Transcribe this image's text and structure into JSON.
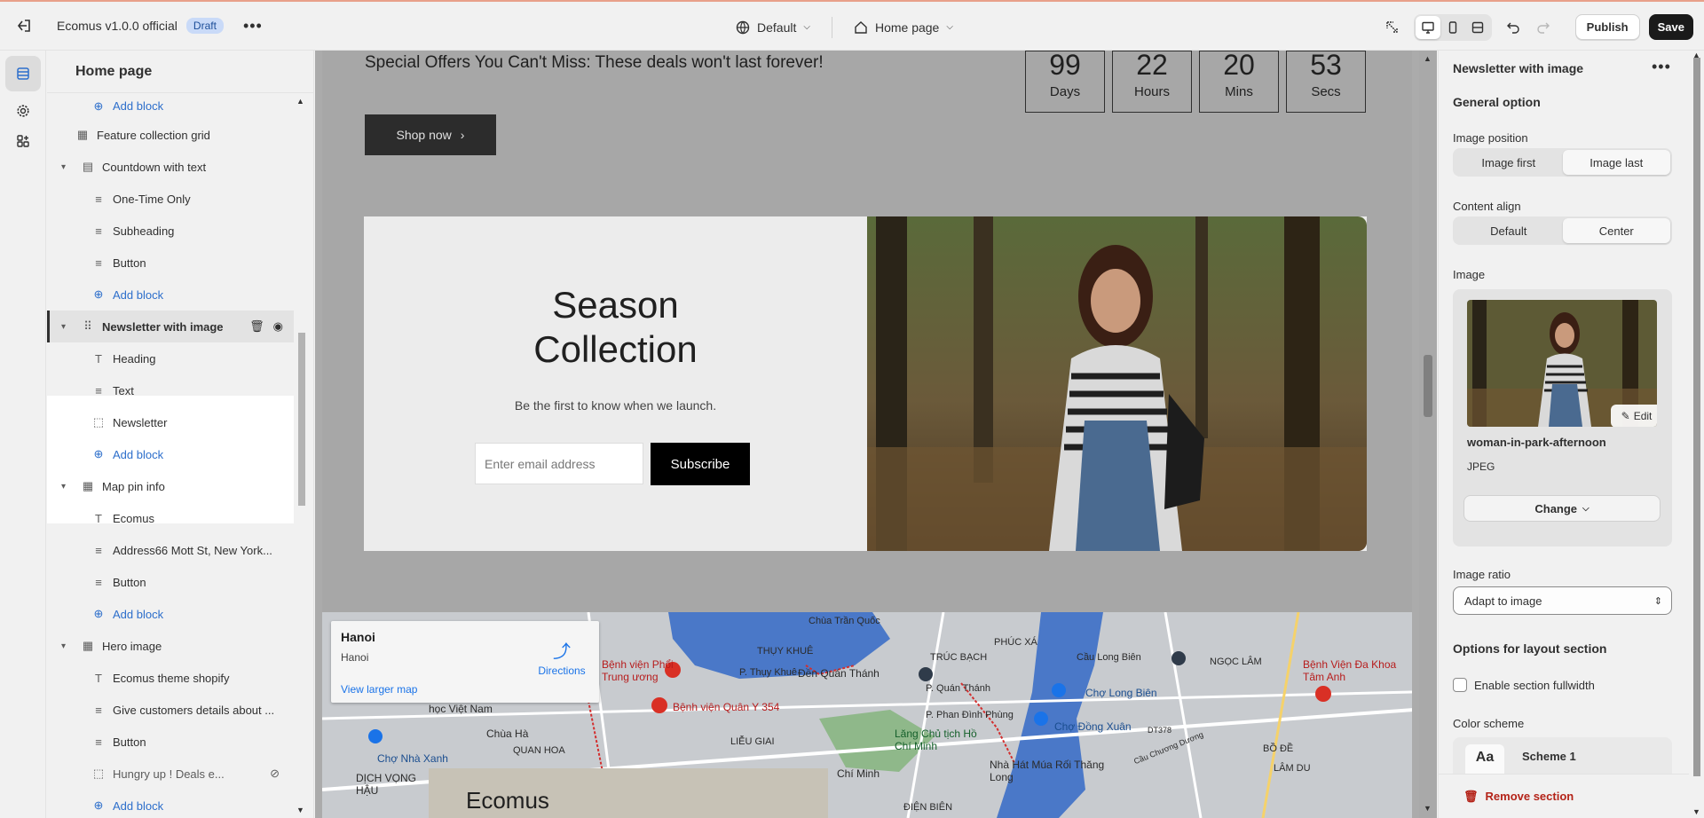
{
  "topbar": {
    "app_title": "Ecomus v1.0.0 official",
    "status_badge": "Draft",
    "theme_select": "Default",
    "page_select": "Home page",
    "publish_label": "Publish",
    "save_label": "Save"
  },
  "left_panel": {
    "title": "Home page",
    "items": [
      {
        "label": "Add block",
        "type": "add"
      },
      {
        "label": "Feature collection grid",
        "type": "top-block",
        "icon": "image-icon"
      },
      {
        "label": "Countdown with text",
        "type": "section",
        "icon": "section-icon"
      },
      {
        "label": "One-Time Only",
        "type": "block",
        "icon": "text-lines-icon"
      },
      {
        "label": "Subheading",
        "type": "block",
        "icon": "text-lines-icon"
      },
      {
        "label": "Button",
        "type": "block",
        "icon": "text-lines-icon"
      },
      {
        "label": "Add block",
        "type": "add"
      },
      {
        "label": "Newsletter with image",
        "type": "section-selected"
      },
      {
        "label": "Heading",
        "type": "block",
        "icon": "heading-icon"
      },
      {
        "label": "Text",
        "type": "block",
        "icon": "text-lines-icon"
      },
      {
        "label": "Newsletter",
        "type": "block",
        "icon": "dashed-box-icon"
      },
      {
        "label": "Add block",
        "type": "add"
      },
      {
        "label": "Map pin info",
        "type": "section",
        "icon": "image-icon"
      },
      {
        "label": "Ecomus",
        "type": "block",
        "icon": "heading-icon"
      },
      {
        "label": "Address66 Mott St, New York...",
        "type": "block",
        "icon": "text-lines-icon"
      },
      {
        "label": "Button",
        "type": "block",
        "icon": "text-lines-icon"
      },
      {
        "label": "Add block",
        "type": "add"
      },
      {
        "label": "Hero image",
        "type": "section",
        "icon": "image-icon"
      },
      {
        "label": "Ecomus theme shopify",
        "type": "block",
        "icon": "heading-icon"
      },
      {
        "label": "Give customers details about ...",
        "type": "block",
        "icon": "text-lines-icon"
      },
      {
        "label": "Button",
        "type": "block",
        "icon": "text-lines-icon"
      },
      {
        "label": "Hungry up ! Deals e...",
        "type": "block-hidden",
        "icon": "dashed-box-icon"
      },
      {
        "label": "Add block",
        "type": "add"
      }
    ]
  },
  "canvas": {
    "offer_text": "Special Offers You Can't Miss: These deals won't last forever!",
    "countdown": [
      {
        "num": "99",
        "unit": "Days"
      },
      {
        "num": "22",
        "unit": "Hours"
      },
      {
        "num": "20",
        "unit": "Mins"
      },
      {
        "num": "53",
        "unit": "Secs"
      }
    ],
    "shop_button": "Shop now",
    "newsletter": {
      "heading_line1": "Season",
      "heading_line2": "Collection",
      "text": "Be the first to know when we launch.",
      "email_placeholder": "Enter email address",
      "subscribe": "Subscribe"
    },
    "map": {
      "card_title": "Hanoi",
      "card_sub": "Hanoi",
      "directions": "Directions",
      "larger_map": "View larger map",
      "labels": [
        {
          "text": "Chùa Trần Quốc",
          "cls": ""
        },
        {
          "text": "THỤY KHUÊ",
          "cls": ""
        },
        {
          "text": "PHÚC XÁ",
          "cls": ""
        },
        {
          "text": "TRÚC BẠCH",
          "cls": ""
        },
        {
          "text": "Cầu Long Biên",
          "cls": ""
        },
        {
          "text": "NGỌC LÂM",
          "cls": ""
        },
        {
          "text": "Bệnh Viện Đa Khoa Tâm Anh",
          "cls": "red"
        },
        {
          "text": "Bệnh viện Phổi Trung ương",
          "cls": "red"
        },
        {
          "text": "P. Thụy Khuê",
          "cls": ""
        },
        {
          "text": "Đền Quán Thánh",
          "cls": ""
        },
        {
          "text": "P. Quán Thánh",
          "cls": ""
        },
        {
          "text": "Chợ Long Biên",
          "cls": "blue"
        },
        {
          "text": "học Việt Nam",
          "cls": ""
        },
        {
          "text": "Bệnh viện Quân Y 354",
          "cls": "red"
        },
        {
          "text": "P. Phan Đình Phùng",
          "cls": ""
        },
        {
          "text": "Chợ Đồng Xuân",
          "cls": "blue"
        },
        {
          "text": "Chùa Hà",
          "cls": ""
        },
        {
          "text": "QUAN HOA",
          "cls": ""
        },
        {
          "text": "LIỄU GIAI",
          "cls": ""
        },
        {
          "text": "Lăng Chủ tịch Hồ Chí Minh",
          "cls": "green"
        },
        {
          "text": "DT378",
          "cls": ""
        },
        {
          "text": "BỒ ĐỀ",
          "cls": ""
        },
        {
          "text": "Chợ Nhà Xanh",
          "cls": "blue"
        },
        {
          "text": "Nhà Hát Múa Rối Thăng Long",
          "cls": ""
        },
        {
          "text": "LÂM DU",
          "cls": ""
        },
        {
          "text": "DỊCH VỌNG HẬU",
          "cls": ""
        },
        {
          "text": "Chí Minh",
          "cls": ""
        },
        {
          "text": "ĐIỆN BIÊN",
          "cls": ""
        },
        {
          "text": "Cầu Chương Dương",
          "cls": ""
        }
      ],
      "footer_text": "Ecomus"
    }
  },
  "right_panel": {
    "title": "Newsletter with image",
    "general_option": "General option",
    "image_position_label": "Image position",
    "image_position_options": [
      "Image first",
      "Image last"
    ],
    "content_align_label": "Content align",
    "content_align_options": [
      "Default",
      "Center"
    ],
    "image_label": "Image",
    "edit_label": "Edit",
    "image_name": "woman-in-park-afternoon",
    "image_type": "JPEG",
    "change_label": "Change",
    "image_ratio_label": "Image ratio",
    "image_ratio_value": "Adapt to image",
    "layout_title": "Options for layout section",
    "fullwidth_label": "Enable section fullwidth",
    "color_scheme_label": "Color scheme",
    "scheme_name": "Scheme 1",
    "scheme_preview": "Aa",
    "remove_label": "Remove section"
  }
}
